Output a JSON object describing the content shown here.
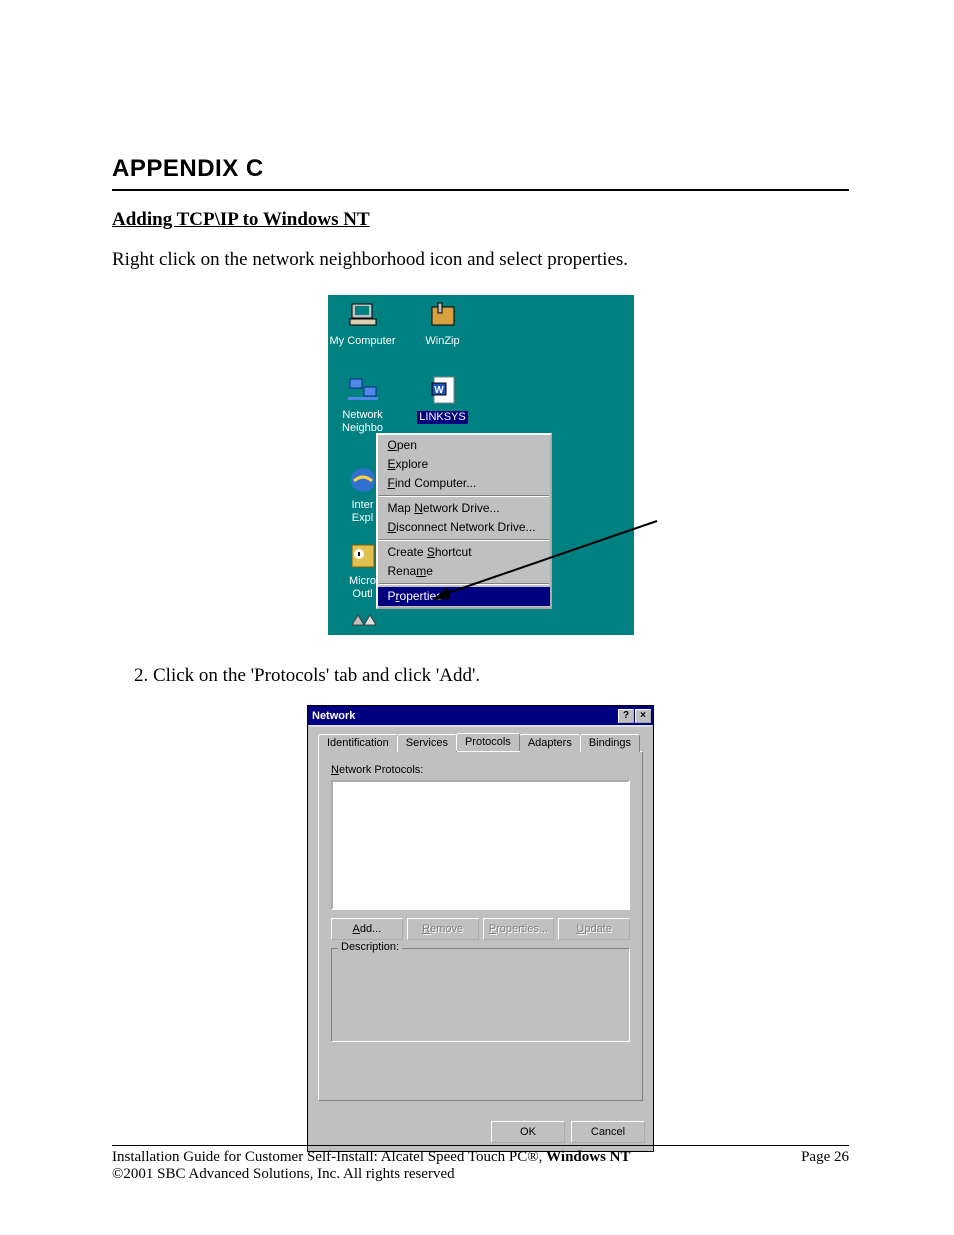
{
  "doc": {
    "appendix": "APPENDIX  C",
    "section": "Adding TCP\\IP to Windows NT",
    "intro": "Right click on the network neighborhood icon and select properties.",
    "step2": "2.  Click on the 'Protocols' tab and click 'Add'."
  },
  "desktop": {
    "icons": {
      "mycomputer": "My Computer",
      "winzip": "WinZip",
      "network": "Network",
      "neighbo": "Neighbo",
      "linksys": "LINKSYS",
      "ie1": "Inter",
      "ie2": "Expl",
      "outlook1": "Micro",
      "outlook2": "Outl"
    },
    "menu": {
      "open": "Open",
      "explore": "Explore",
      "find": "Find Computer...",
      "map": "Map Network Drive...",
      "disconnect": "Disconnect Network Drive...",
      "shortcut": "Create Shortcut",
      "rename": "Rename",
      "properties": "Properties"
    }
  },
  "dialog": {
    "title": "Network",
    "tabs": {
      "identification": "Identification",
      "services": "Services",
      "protocols": "Protocols",
      "adapters": "Adapters",
      "bindings": "Bindings"
    },
    "labels": {
      "netprot": "Network Protocols:",
      "description": "Description:"
    },
    "buttons": {
      "add": "Add...",
      "remove": "Remove",
      "properties": "Properties...",
      "update": "Update",
      "ok": "OK",
      "cancel": "Cancel",
      "help": "?",
      "close": "×"
    }
  },
  "footer": {
    "line1a": "Installation Guide for Customer Self-Install: Alcatel Speed Touch PC®, ",
    "line1b": "Windows NT",
    "page": "Page 26",
    "line2": "©2001 SBC Advanced Solutions, Inc.  All rights reserved"
  }
}
